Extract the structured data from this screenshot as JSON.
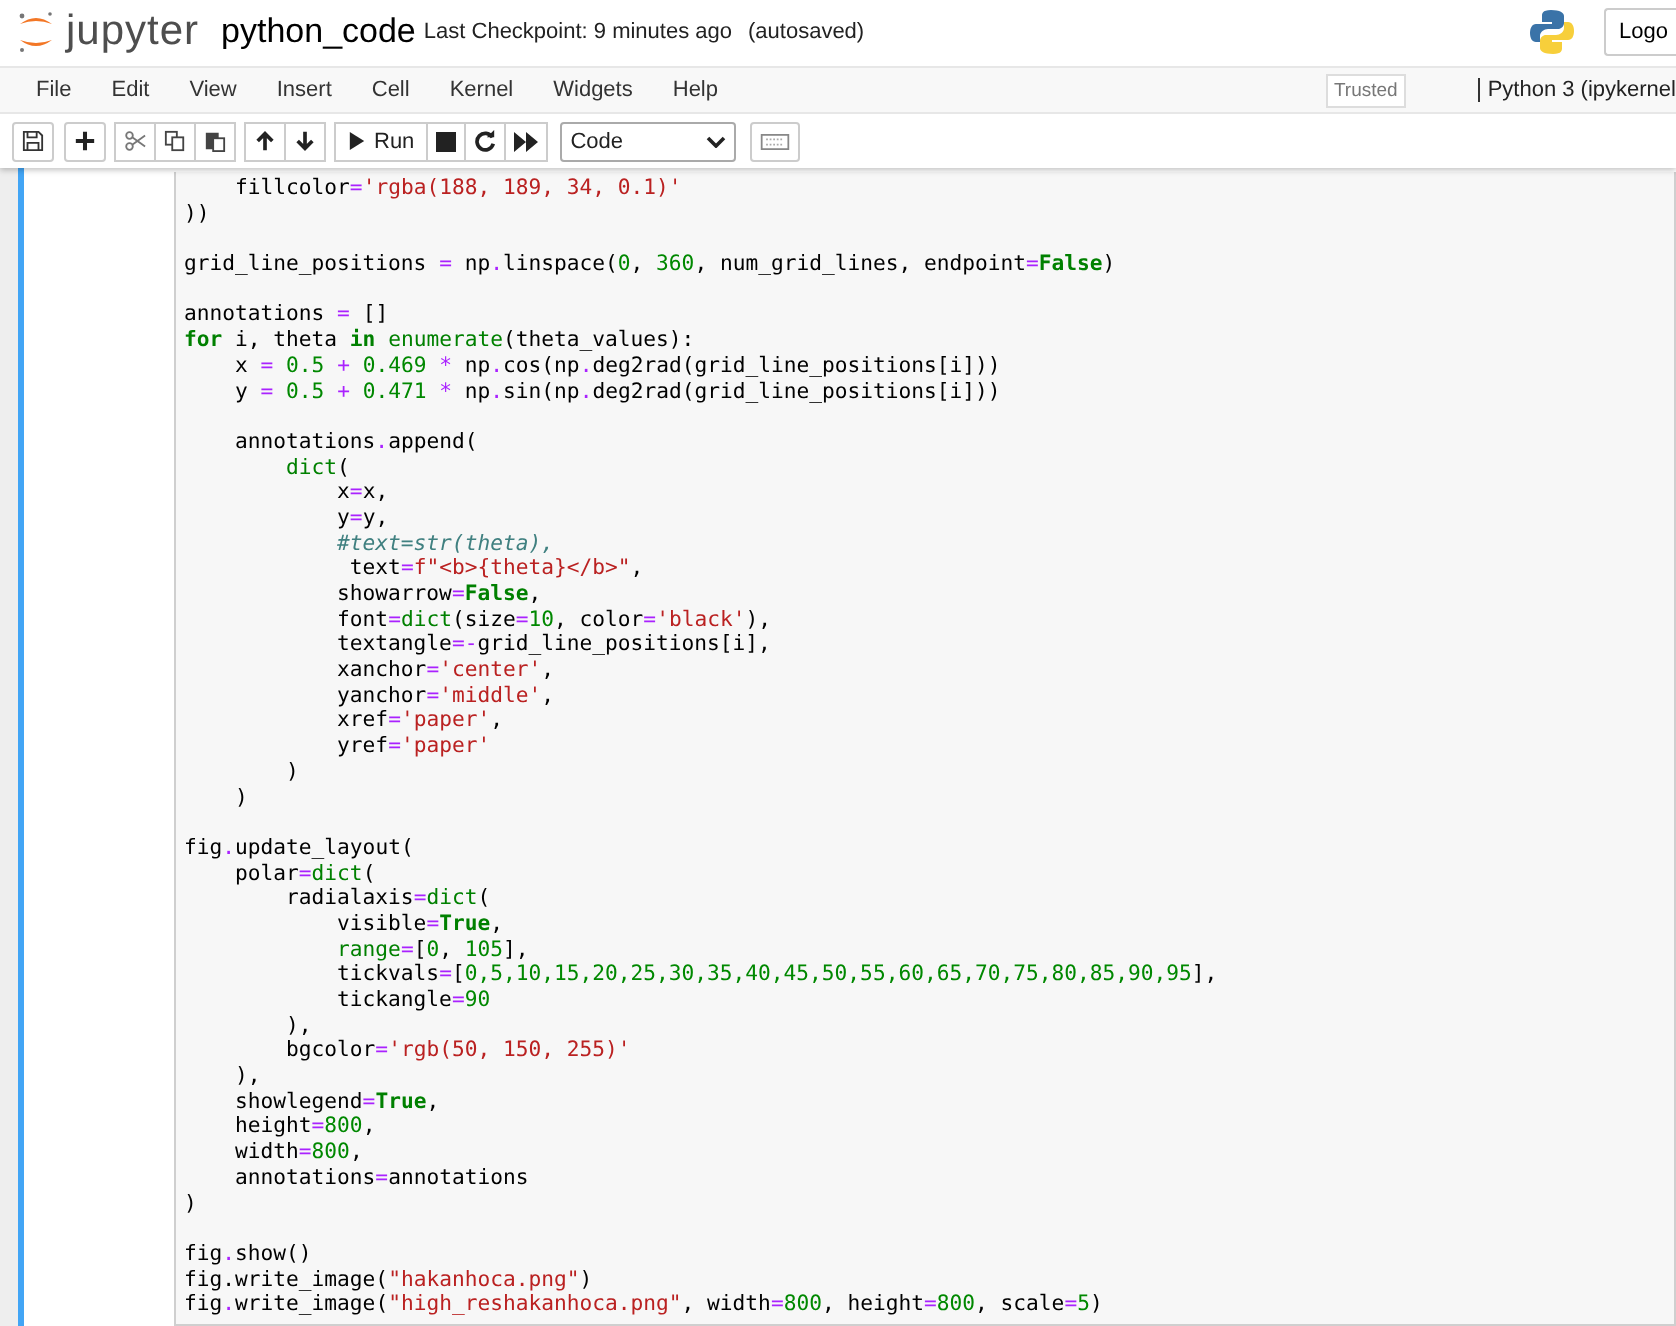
{
  "header": {
    "logo_text": "jupyter",
    "notebook_name": "python_code",
    "checkpoint": "Last Checkpoint: 9 minutes ago",
    "autosave": "(autosaved)",
    "logout": "Logo"
  },
  "menu": [
    "File",
    "Edit",
    "View",
    "Insert",
    "Cell",
    "Kernel",
    "Widgets",
    "Help"
  ],
  "trusted": "Trusted",
  "kernel": "Python 3 (ipykernel",
  "toolbar": {
    "run_label": "Run",
    "cell_type": "Code"
  },
  "cell": {
    "selected": true,
    "lines": [
      {
        "tokens": [
          {
            "kind": "plain",
            "text": "    fillcolor"
          },
          {
            "kind": "op",
            "text": "="
          },
          {
            "kind": "str",
            "text": "'rgba(188, 189, 34, 0.1)'"
          }
        ]
      },
      {
        "tokens": [
          {
            "kind": "plain",
            "text": "))"
          }
        ]
      },
      {
        "kind": "blank"
      },
      {
        "tokens": [
          {
            "kind": "plain",
            "text": "grid_line_positions "
          },
          {
            "kind": "op",
            "text": "="
          },
          {
            "kind": "plain",
            "text": " np"
          },
          {
            "kind": "op",
            "text": "."
          },
          {
            "kind": "plain",
            "text": "linspace("
          },
          {
            "kind": "num",
            "text": "0"
          },
          {
            "kind": "plain",
            "text": ", "
          },
          {
            "kind": "num",
            "text": "360"
          },
          {
            "kind": "plain",
            "text": ", num_grid_lines, endpoint"
          },
          {
            "kind": "op",
            "text": "="
          },
          {
            "kind": "kw",
            "text": "False"
          },
          {
            "kind": "plain",
            "text": ")"
          }
        ]
      },
      {
        "kind": "blank"
      },
      {
        "tokens": [
          {
            "kind": "plain",
            "text": "annotations "
          },
          {
            "kind": "op",
            "text": "="
          },
          {
            "kind": "plain",
            "text": " []"
          }
        ]
      },
      {
        "tokens": [
          {
            "kind": "kw",
            "text": "for"
          },
          {
            "kind": "plain",
            "text": " i, theta "
          },
          {
            "kind": "kw",
            "text": "in"
          },
          {
            "kind": "builtin",
            "text": " enumerate"
          },
          {
            "kind": "plain",
            "text": "(theta_values):"
          }
        ]
      },
      {
        "tokens": [
          {
            "kind": "plain",
            "text": "    x "
          },
          {
            "kind": "op",
            "text": "="
          },
          {
            "kind": "num",
            "text": " 0.5"
          },
          {
            "kind": "op",
            "text": " +"
          },
          {
            "kind": "num",
            "text": " 0.469"
          },
          {
            "kind": "op",
            "text": " *"
          },
          {
            "kind": "plain",
            "text": " np"
          },
          {
            "kind": "op",
            "text": "."
          },
          {
            "kind": "plain",
            "text": "cos(np"
          },
          {
            "kind": "op",
            "text": "."
          },
          {
            "kind": "plain",
            "text": "deg2rad(grid_line_positions[i]))"
          }
        ]
      },
      {
        "tokens": [
          {
            "kind": "plain",
            "text": "    y "
          },
          {
            "kind": "op",
            "text": "="
          },
          {
            "kind": "num",
            "text": " 0.5"
          },
          {
            "kind": "op",
            "text": " +"
          },
          {
            "kind": "num",
            "text": " 0.471"
          },
          {
            "kind": "op",
            "text": " *"
          },
          {
            "kind": "plain",
            "text": " np"
          },
          {
            "kind": "op",
            "text": "."
          },
          {
            "kind": "plain",
            "text": "sin(np"
          },
          {
            "kind": "op",
            "text": "."
          },
          {
            "kind": "plain",
            "text": "deg2rad(grid_line_positions[i]))"
          }
        ]
      },
      {
        "kind": "blank"
      },
      {
        "tokens": [
          {
            "kind": "plain",
            "text": "    annotations"
          },
          {
            "kind": "op",
            "text": "."
          },
          {
            "kind": "plain",
            "text": "append("
          }
        ]
      },
      {
        "tokens": [
          {
            "kind": "builtin",
            "text": "        dict"
          },
          {
            "kind": "plain",
            "text": "("
          }
        ]
      },
      {
        "tokens": [
          {
            "kind": "plain",
            "text": "            x"
          },
          {
            "kind": "op",
            "text": "="
          },
          {
            "kind": "plain",
            "text": "x,"
          }
        ]
      },
      {
        "tokens": [
          {
            "kind": "plain",
            "text": "            y"
          },
          {
            "kind": "op",
            "text": "="
          },
          {
            "kind": "plain",
            "text": "y,"
          }
        ]
      },
      {
        "tokens": [
          {
            "kind": "comment",
            "text": "            #text=str(theta),"
          }
        ]
      },
      {
        "tokens": [
          {
            "kind": "plain",
            "text": "             text"
          },
          {
            "kind": "op",
            "text": "="
          },
          {
            "kind": "str",
            "text": "f\"<b>{theta}</b>\""
          },
          {
            "kind": "plain",
            "text": ","
          }
        ]
      },
      {
        "tokens": [
          {
            "kind": "plain",
            "text": "            showarrow"
          },
          {
            "kind": "op",
            "text": "="
          },
          {
            "kind": "kw",
            "text": "False"
          },
          {
            "kind": "plain",
            "text": ","
          }
        ]
      },
      {
        "tokens": [
          {
            "kind": "plain",
            "text": "            font"
          },
          {
            "kind": "op",
            "text": "="
          },
          {
            "kind": "builtin",
            "text": "dict"
          },
          {
            "kind": "plain",
            "text": "(size"
          },
          {
            "kind": "op",
            "text": "="
          },
          {
            "kind": "num",
            "text": "10"
          },
          {
            "kind": "plain",
            "text": ", color"
          },
          {
            "kind": "op",
            "text": "="
          },
          {
            "kind": "str",
            "text": "'black'"
          },
          {
            "kind": "plain",
            "text": "),"
          }
        ]
      },
      {
        "tokens": [
          {
            "kind": "plain",
            "text": "            textangle"
          },
          {
            "kind": "op",
            "text": "=-"
          },
          {
            "kind": "plain",
            "text": "grid_line_positions[i],"
          }
        ]
      },
      {
        "tokens": [
          {
            "kind": "plain",
            "text": "            xanchor"
          },
          {
            "kind": "op",
            "text": "="
          },
          {
            "kind": "str",
            "text": "'center'"
          },
          {
            "kind": "plain",
            "text": ","
          }
        ]
      },
      {
        "tokens": [
          {
            "kind": "plain",
            "text": "            yanchor"
          },
          {
            "kind": "op",
            "text": "="
          },
          {
            "kind": "str",
            "text": "'middle'"
          },
          {
            "kind": "plain",
            "text": ","
          }
        ]
      },
      {
        "tokens": [
          {
            "kind": "plain",
            "text": "            xref"
          },
          {
            "kind": "op",
            "text": "="
          },
          {
            "kind": "str",
            "text": "'paper'"
          },
          {
            "kind": "plain",
            "text": ","
          }
        ]
      },
      {
        "tokens": [
          {
            "kind": "plain",
            "text": "            yref"
          },
          {
            "kind": "op",
            "text": "="
          },
          {
            "kind": "str",
            "text": "'paper'"
          }
        ]
      },
      {
        "tokens": [
          {
            "kind": "plain",
            "text": "        )"
          }
        ]
      },
      {
        "tokens": [
          {
            "kind": "plain",
            "text": "    )"
          }
        ]
      },
      {
        "kind": "blank"
      },
      {
        "tokens": [
          {
            "kind": "plain",
            "text": "fig"
          },
          {
            "kind": "op",
            "text": "."
          },
          {
            "kind": "plain",
            "text": "update_layout("
          }
        ]
      },
      {
        "tokens": [
          {
            "kind": "plain",
            "text": "    polar"
          },
          {
            "kind": "op",
            "text": "="
          },
          {
            "kind": "builtin",
            "text": "dict"
          },
          {
            "kind": "plain",
            "text": "("
          }
        ]
      },
      {
        "tokens": [
          {
            "kind": "plain",
            "text": "        radialaxis"
          },
          {
            "kind": "op",
            "text": "="
          },
          {
            "kind": "builtin",
            "text": "dict"
          },
          {
            "kind": "plain",
            "text": "("
          }
        ]
      },
      {
        "tokens": [
          {
            "kind": "plain",
            "text": "            visible"
          },
          {
            "kind": "op",
            "text": "="
          },
          {
            "kind": "kw",
            "text": "True"
          },
          {
            "kind": "plain",
            "text": ","
          }
        ]
      },
      {
        "tokens": [
          {
            "kind": "builtin",
            "text": "            range"
          },
          {
            "kind": "op",
            "text": "="
          },
          {
            "kind": "plain",
            "text": "["
          },
          {
            "kind": "num",
            "text": "0"
          },
          {
            "kind": "plain",
            "text": ", "
          },
          {
            "kind": "num",
            "text": "105"
          },
          {
            "kind": "plain",
            "text": "],"
          }
        ]
      },
      {
        "tokens": [
          {
            "kind": "plain",
            "text": "            tickvals"
          },
          {
            "kind": "op",
            "text": "="
          },
          {
            "kind": "plain",
            "text": "["
          },
          {
            "kind": "num",
            "text": "0,5,10,15,20,25,30,35,40,45,50,55,60,65,70,75,80,85,90,95"
          },
          {
            "kind": "plain",
            "text": "],"
          }
        ]
      },
      {
        "tokens": [
          {
            "kind": "plain",
            "text": "            tickangle"
          },
          {
            "kind": "op",
            "text": "="
          },
          {
            "kind": "num",
            "text": "90"
          }
        ]
      },
      {
        "tokens": [
          {
            "kind": "plain",
            "text": "        ),"
          }
        ]
      },
      {
        "tokens": [
          {
            "kind": "plain",
            "text": "        bgcolor"
          },
          {
            "kind": "op",
            "text": "="
          },
          {
            "kind": "str",
            "text": "'rgb(50, 150, 255)'"
          }
        ]
      },
      {
        "tokens": [
          {
            "kind": "plain",
            "text": "    ),"
          }
        ]
      },
      {
        "tokens": [
          {
            "kind": "plain",
            "text": "    showlegend"
          },
          {
            "kind": "op",
            "text": "="
          },
          {
            "kind": "kw",
            "text": "True"
          },
          {
            "kind": "plain",
            "text": ","
          }
        ]
      },
      {
        "tokens": [
          {
            "kind": "plain",
            "text": "    height"
          },
          {
            "kind": "op",
            "text": "="
          },
          {
            "kind": "num",
            "text": "800"
          },
          {
            "kind": "plain",
            "text": ","
          }
        ]
      },
      {
        "tokens": [
          {
            "kind": "plain",
            "text": "    width"
          },
          {
            "kind": "op",
            "text": "="
          },
          {
            "kind": "num",
            "text": "800"
          },
          {
            "kind": "plain",
            "text": ","
          }
        ]
      },
      {
        "tokens": [
          {
            "kind": "plain",
            "text": "    annotations"
          },
          {
            "kind": "op",
            "text": "="
          },
          {
            "kind": "plain",
            "text": "annotations"
          }
        ]
      },
      {
        "tokens": [
          {
            "kind": "plain",
            "text": ")"
          }
        ]
      },
      {
        "kind": "blank"
      },
      {
        "tokens": [
          {
            "kind": "plain",
            "text": "fig"
          },
          {
            "kind": "op",
            "text": "."
          },
          {
            "kind": "plain",
            "text": "show()"
          }
        ]
      },
      {
        "tokens": [
          {
            "kind": "plain",
            "text": "fig.write_image("
          },
          {
            "kind": "str",
            "text": "\"hakanhoca.png\""
          },
          {
            "kind": "plain",
            "text": ")"
          }
        ]
      },
      {
        "tokens": [
          {
            "kind": "plain",
            "text": "fig"
          },
          {
            "kind": "op",
            "text": "."
          },
          {
            "kind": "plain",
            "text": "write_image("
          },
          {
            "kind": "str",
            "text": "\"high_reshakanhoca.png\""
          },
          {
            "kind": "plain",
            "text": ", width"
          },
          {
            "kind": "op",
            "text": "="
          },
          {
            "kind": "num",
            "text": "800"
          },
          {
            "kind": "plain",
            "text": ", height"
          },
          {
            "kind": "op",
            "text": "="
          },
          {
            "kind": "num",
            "text": "800"
          },
          {
            "kind": "plain",
            "text": ", scale"
          },
          {
            "kind": "op",
            "text": "="
          },
          {
            "kind": "num",
            "text": "5"
          },
          {
            "kind": "plain",
            "text": ")"
          }
        ]
      }
    ]
  }
}
